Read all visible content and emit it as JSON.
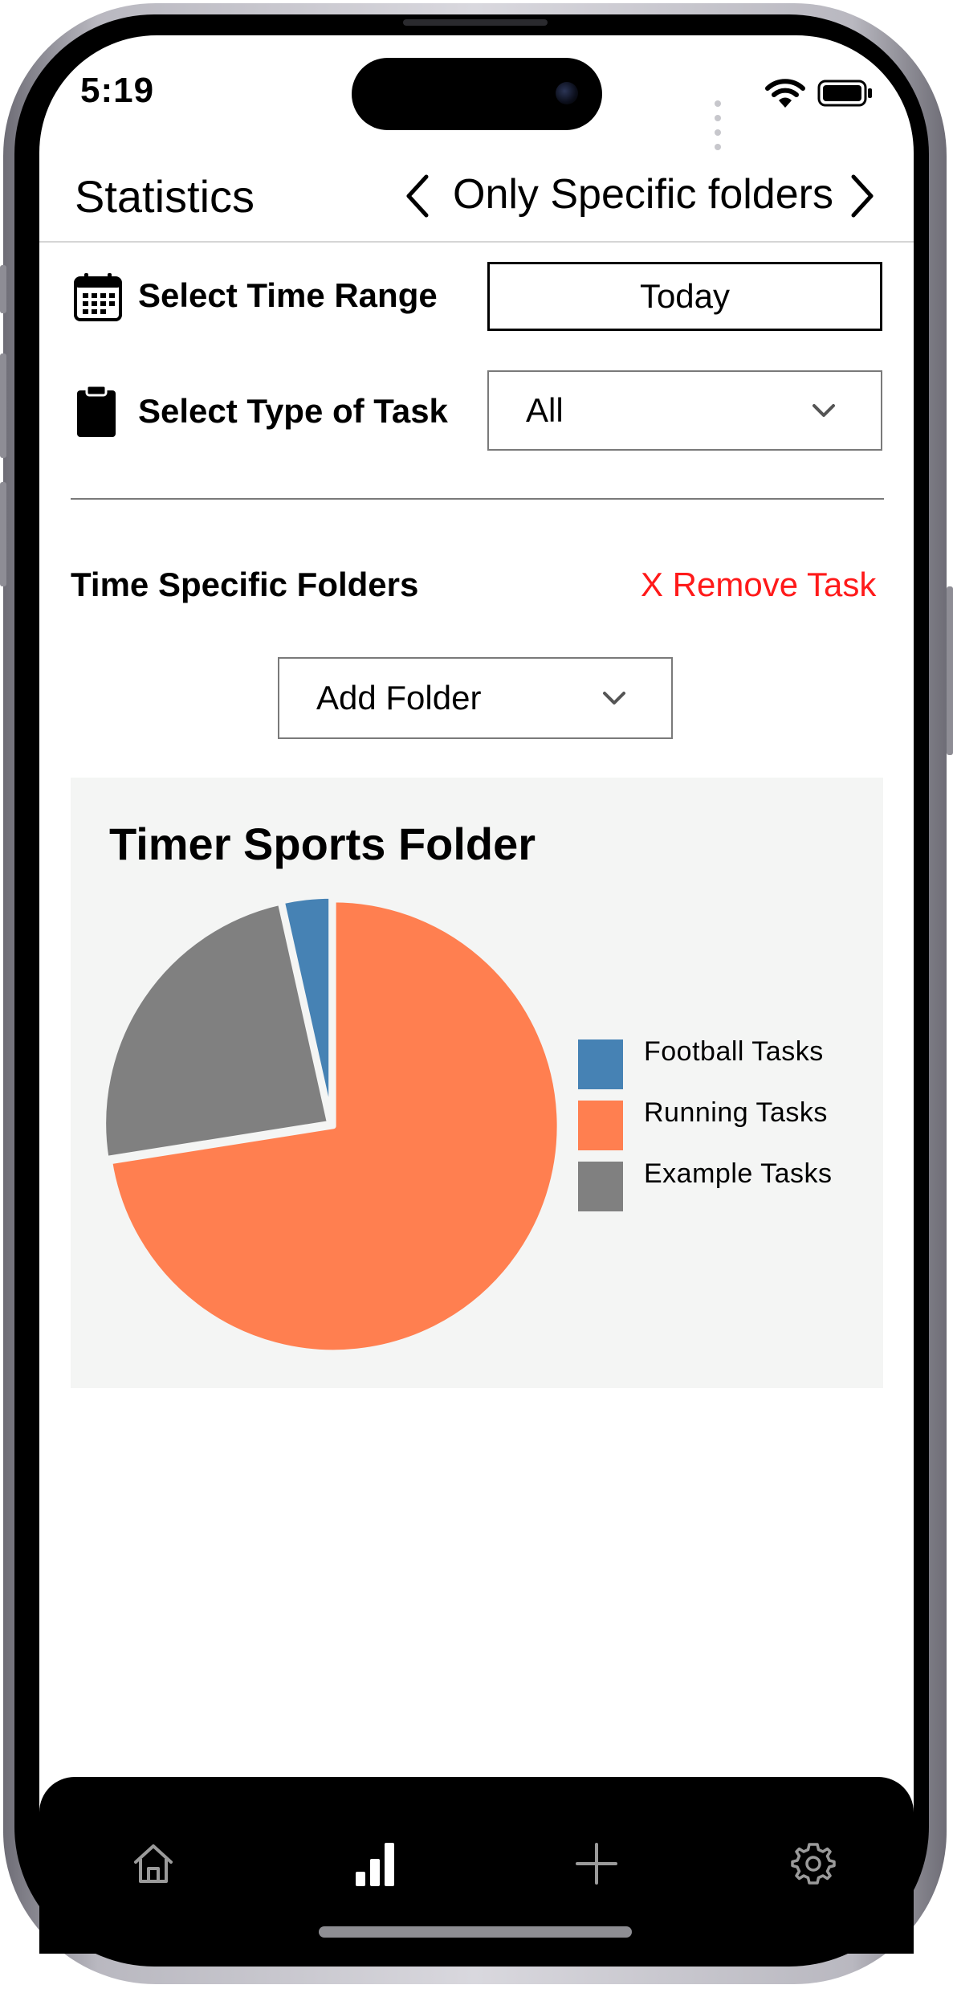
{
  "status_bar": {
    "time": "5:19"
  },
  "nav": {
    "title": "Statistics",
    "subtitle": "Only Specific folders"
  },
  "filters": {
    "time_range_label": "Select Time Range",
    "time_range_value": "Today",
    "task_type_label": "Select Type of Task",
    "task_type_value": "All"
  },
  "folders": {
    "section_title": "Time Specific Folders",
    "remove_label": "X Remove Task",
    "add_folder_label": "Add Folder"
  },
  "chart_data": {
    "type": "pie",
    "title": "Timer Sports Folder",
    "categories": [
      "Football Tasks",
      "Running Tasks",
      "Example Tasks"
    ],
    "values": [
      3.5,
      72.5,
      24.0
    ],
    "colors": [
      "#4682b4",
      "#ff7f50",
      "#808080"
    ],
    "legend_position": "right"
  },
  "icons": {
    "calendar": "calendar-icon",
    "clipboard": "clipboard-icon",
    "tabs": [
      "home-icon",
      "bar-chart-icon",
      "plus-icon",
      "gear-icon"
    ]
  }
}
